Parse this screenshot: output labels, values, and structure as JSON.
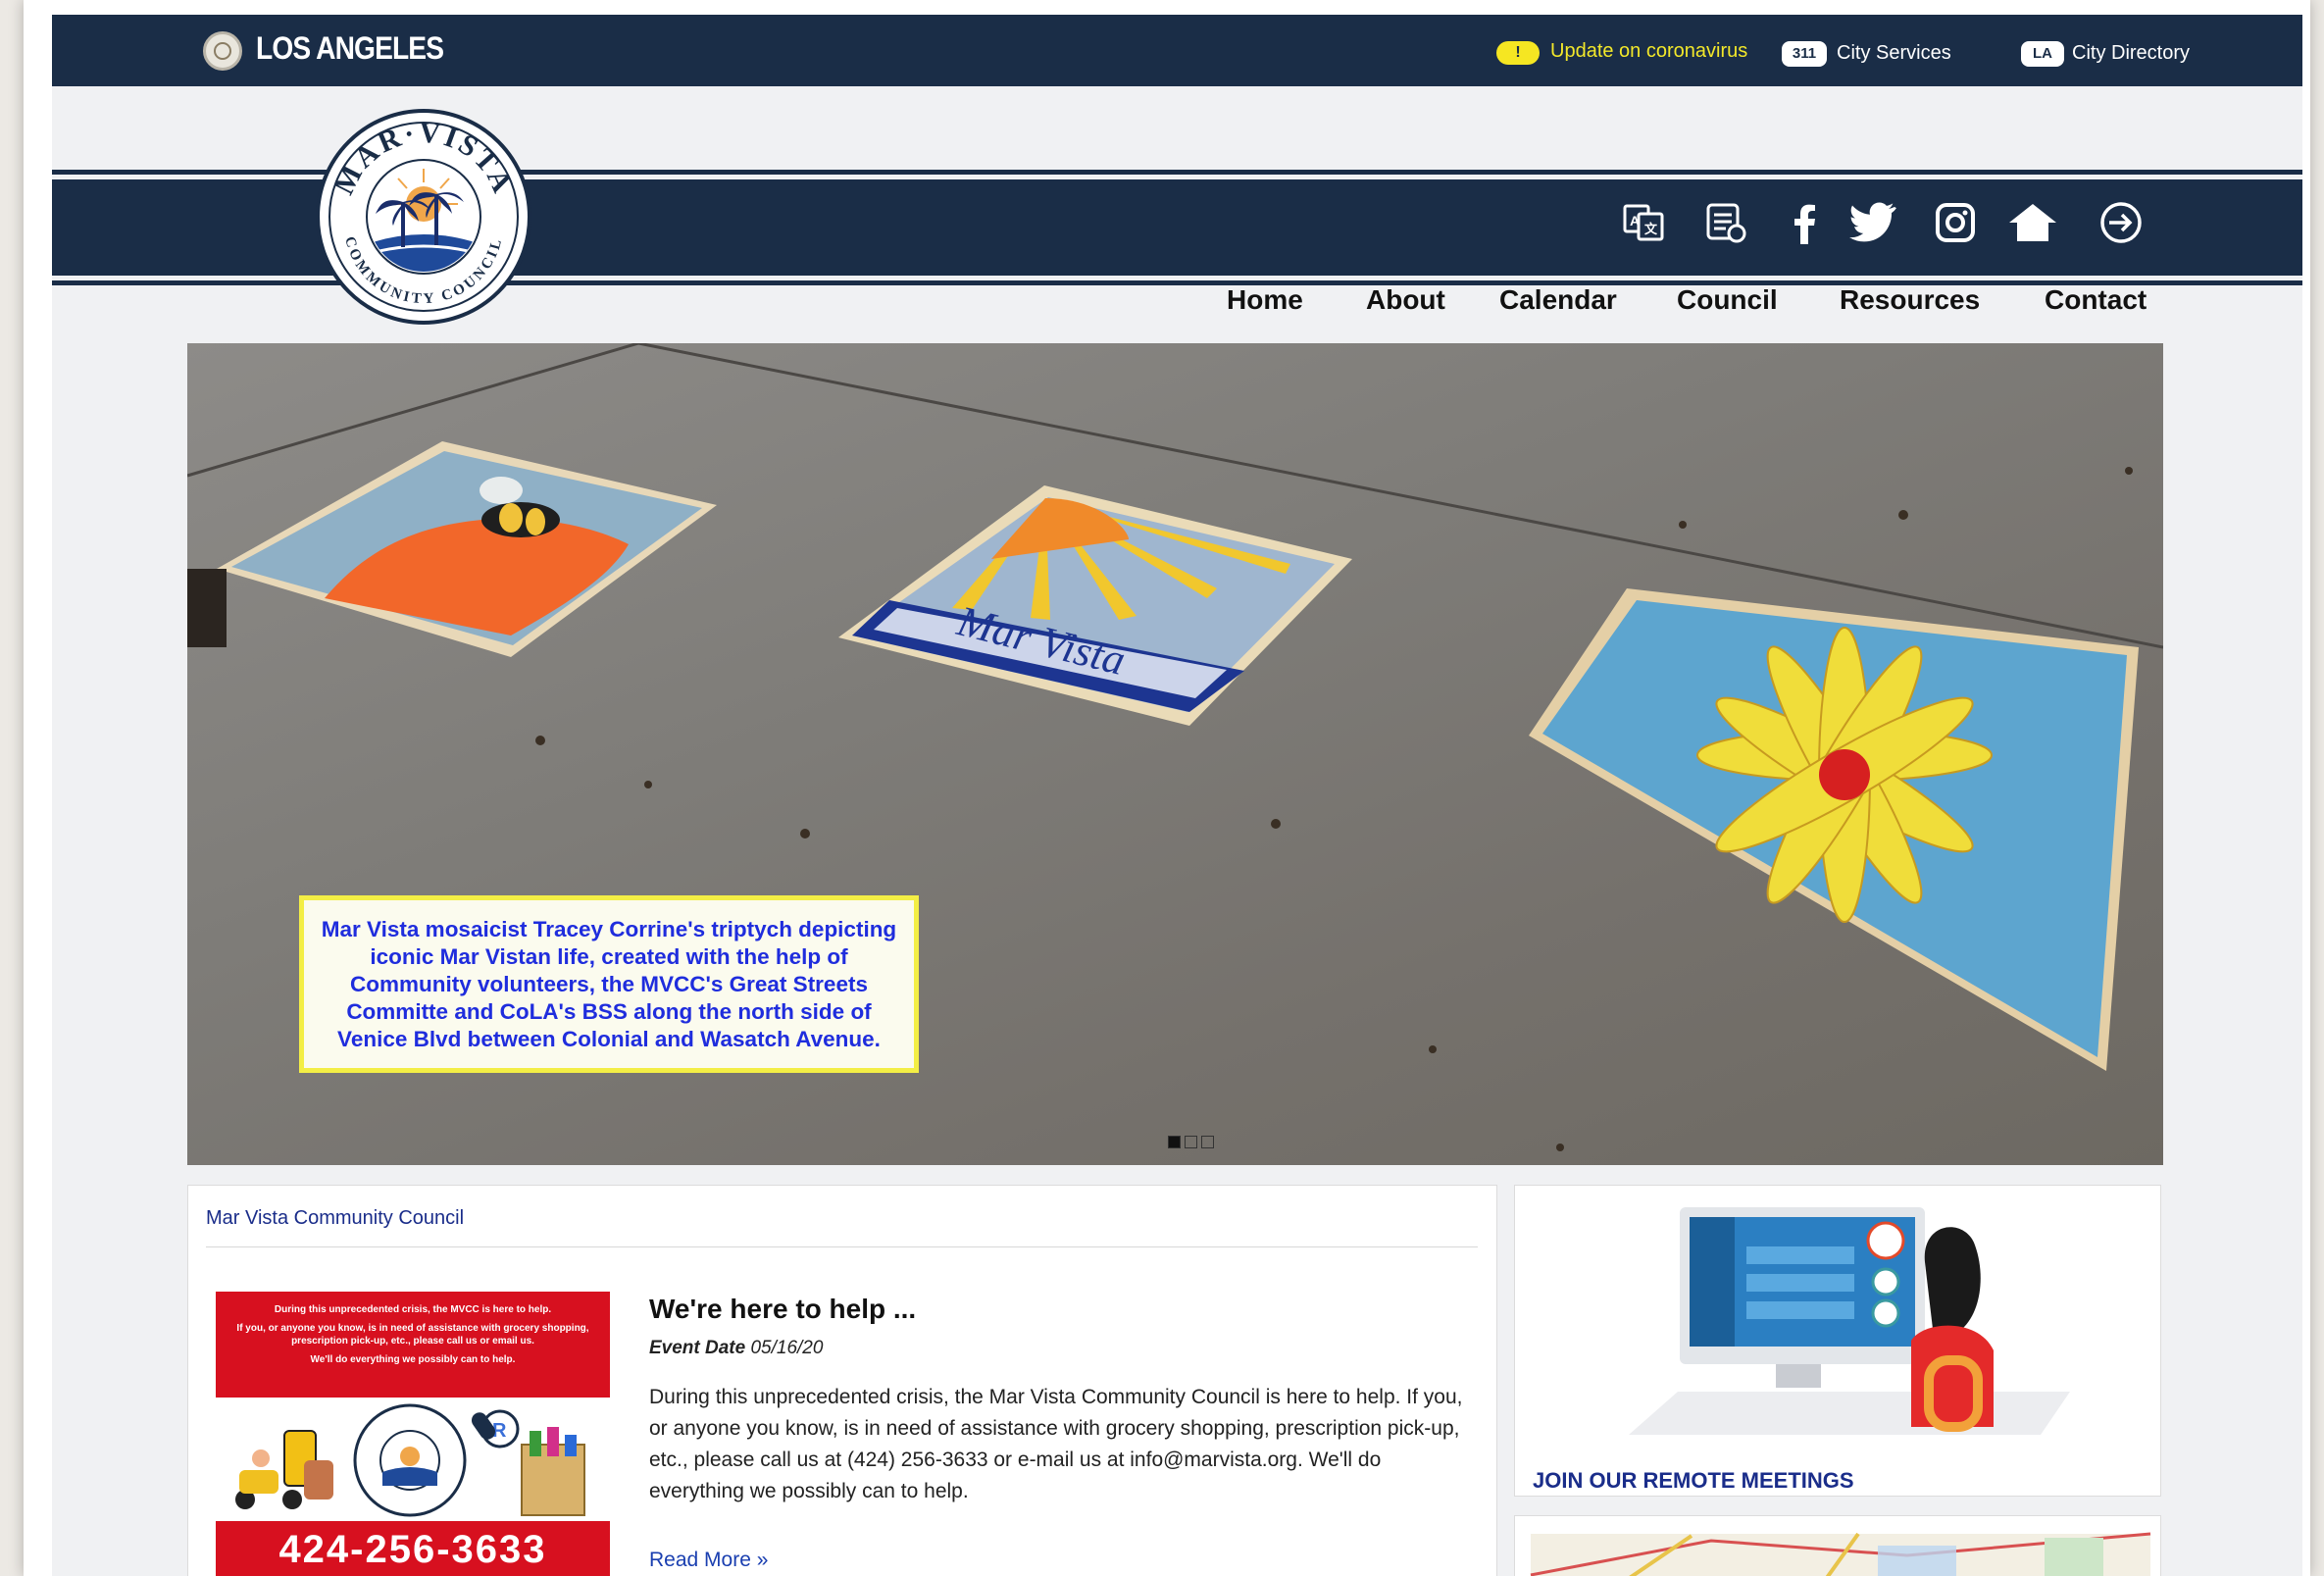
{
  "citybar": {
    "city_name": "LOS ANGELES",
    "alert_badge": "!",
    "alert_text": "Update on coronavirus",
    "services_badge": "311",
    "services_text": "City Services",
    "directory_badge": "LA",
    "directory_text": "City Directory"
  },
  "header": {
    "logo_top_text": "MAR·VISTA",
    "logo_bottom_text": "COMMUNITY COUNCIL",
    "icons": [
      "translate-icon",
      "newsletter-icon",
      "facebook-icon",
      "twitter-icon",
      "instagram-icon",
      "home-icon",
      "login-icon"
    ]
  },
  "nav": {
    "items": [
      "Home",
      "About",
      "Calendar",
      "Council",
      "Resources",
      "Contact"
    ]
  },
  "hero": {
    "caption": "Mar Vista mosaicist Tracey Corrine's triptych depicting iconic Mar Vistan life, created with the help of Community volunteers, the MVCC's Great Streets Committe and CoLA's BSS along the north side of Venice Blvd between Colonial and Wasatch Avenue.",
    "slides_total": 3,
    "active_slide": 1,
    "mosaic_text": "Mar Vista"
  },
  "post": {
    "breadcrumb": "Mar Vista Community Council",
    "title": "We're here to help ...",
    "event_label": "Event Date",
    "event_date": "05/16/20",
    "body": "During this unprecedented crisis, the Mar Vista Community Council is here to help. If you, or anyone you know, is in need of assistance with grocery shopping, prescription pick-up, etc., please call us at (424) 256-3633 or e-mail us at info@marvista.org. We'll do everything we possibly can to help.",
    "read_more": "Read More »",
    "thumb_line1": "During this unprecedented crisis, the MVCC is here to help.",
    "thumb_line2": "If you, or anyone you know, is in need of assistance with grocery shopping, prescription pick-up, etc., please call us or email us.",
    "thumb_line3": "We'll do everything we possibly can to help.",
    "thumb_phone": "424-256-3633"
  },
  "sidebar": {
    "remote_link": "JOIN OUR REMOTE MEETINGS"
  },
  "colors": {
    "navy": "#1a2d47",
    "alert_yellow": "#f5e622",
    "caption_blue": "#1f2ddd",
    "link_blue": "#1a2d8a",
    "thumb_red": "#d7101f"
  }
}
